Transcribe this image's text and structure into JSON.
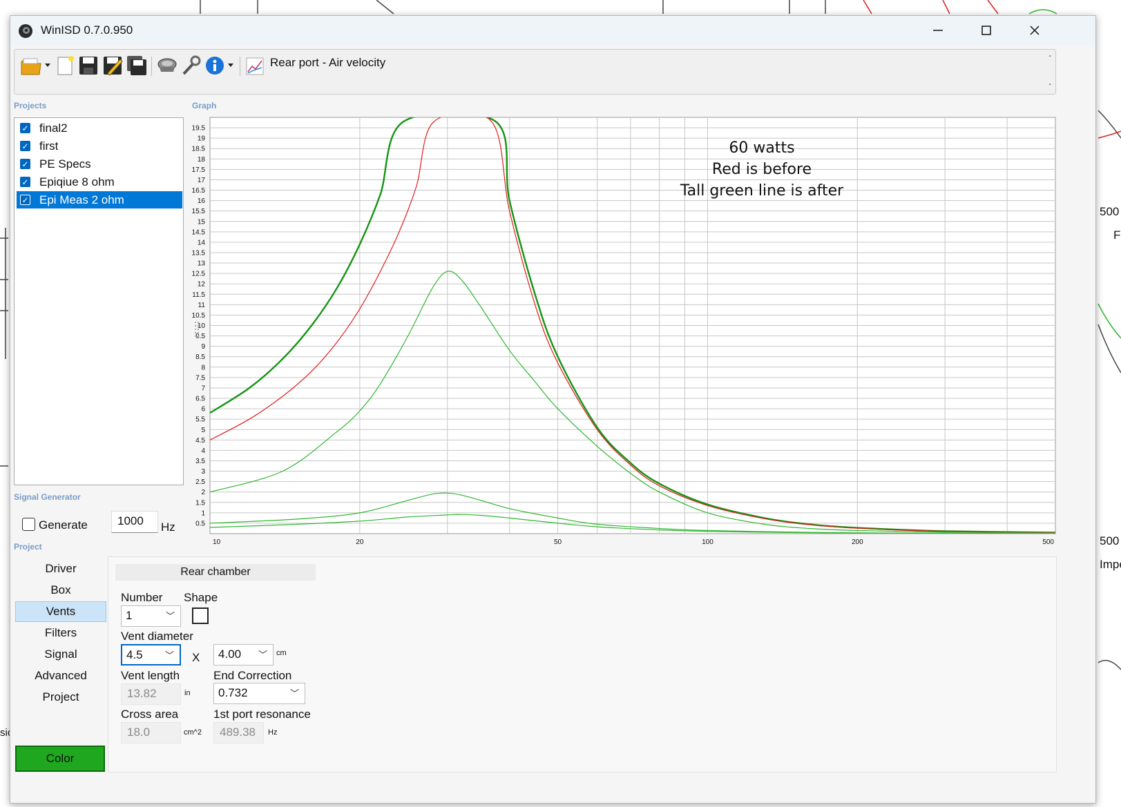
{
  "window": {
    "title": "WinISD 0.7.0.950"
  },
  "toolbar": {
    "icons": [
      "open-folder-icon",
      "new-project-icon",
      "save-icon",
      "save-as-icon",
      "save-all-icon",
      "driver-icon",
      "wrench-icon",
      "info-icon"
    ],
    "graph_selector": "Rear port - Air velocity",
    "dash_top": "-",
    "dash_bottom": "-"
  },
  "labels": {
    "projects": "Projects",
    "graph": "Graph",
    "signal_generator": "Signal Generator",
    "project": "Project"
  },
  "projects": [
    {
      "name": "final2",
      "checked": true,
      "selected": false
    },
    {
      "name": "first",
      "checked": true,
      "selected": false
    },
    {
      "name": "PE Specs",
      "checked": true,
      "selected": false
    },
    {
      "name": "Epiqiue 8 ohm",
      "checked": true,
      "selected": false
    },
    {
      "name": "Epi Meas 2 ohm",
      "checked": true,
      "selected": true
    }
  ],
  "signal": {
    "generate_label": "Generate",
    "frequency": "1000",
    "unit": "Hz"
  },
  "nav": {
    "items": [
      "Driver",
      "Box",
      "Vents",
      "Filters",
      "Signal",
      "Advanced",
      "Project"
    ],
    "active": "Vents"
  },
  "color_button": {
    "label": "Color",
    "color": "#1fa81f"
  },
  "vents": {
    "header": "Rear chamber",
    "number_label": "Number",
    "number_value": "1",
    "shape_label": "Shape",
    "diameter_label": "Vent diameter",
    "diameter_value": "4.5",
    "x_label": "X",
    "second_value": "4.00",
    "second_unit": "cm",
    "length_label": "Vent length",
    "length_value": "13.82",
    "length_unit": "in",
    "end_corr_label": "End Correction",
    "end_corr_value": "0.732",
    "area_label": "Cross area",
    "area_value": "18.0",
    "area_unit": "cm^2",
    "resonance_label": "1st port resonance",
    "resonance_value": "489.38",
    "resonance_unit": "Hz"
  },
  "chart_data": {
    "type": "line",
    "x_scale": "log",
    "xlim": [
      10,
      500
    ],
    "ylim": [
      0,
      20
    ],
    "x_ticks": [
      "10",
      "20",
      "50",
      "100",
      "200",
      "500"
    ],
    "y_ticks": [
      "0.5",
      "1",
      "1.5",
      "2",
      "2.5",
      "3",
      "3.5",
      "4",
      "4.5",
      "5",
      "5.5",
      "6",
      "6.5",
      "7",
      "7.5",
      "8",
      "8.5",
      "9",
      "9.5",
      "10",
      "10.5",
      "11",
      "11.5",
      "12",
      "12.5",
      "13",
      "13.5",
      "14",
      "14.5",
      "15",
      "15.5",
      "16",
      "16.5",
      "17",
      "17.5",
      "18",
      "18.5",
      "19",
      "19.5"
    ],
    "grid": true,
    "annotation": [
      "60 watts",
      "Red is before",
      "Tall green line is after"
    ],
    "series": [
      {
        "color": "#129412",
        "width": 2.4,
        "x": [
          10,
          12,
          14,
          16,
          18,
          20,
          22,
          24.5,
          37.5,
          40,
          45,
          50,
          60,
          70,
          80,
          100,
          130,
          160,
          200,
          300,
          500
        ],
        "values": [
          5.8,
          7.0,
          8.4,
          10.0,
          11.8,
          13.9,
          16.3,
          19.8,
          19.8,
          16.0,
          11.5,
          8.5,
          5.1,
          3.4,
          2.4,
          1.4,
          0.75,
          0.45,
          0.28,
          0.12,
          0.05
        ]
      },
      {
        "color": "#e21b1b",
        "width": 1.2,
        "x": [
          10,
          12,
          14,
          16,
          18,
          20,
          22,
          24,
          26,
          28.2,
          36.8,
          40,
          45,
          50,
          60,
          70,
          80,
          100,
          130,
          160,
          200,
          300,
          500
        ],
        "values": [
          4.5,
          5.5,
          6.6,
          7.8,
          9.2,
          10.8,
          12.6,
          14.5,
          16.7,
          19.8,
          19.8,
          15.5,
          11.0,
          8.2,
          5.0,
          3.3,
          2.3,
          1.35,
          0.72,
          0.43,
          0.26,
          0.11,
          0.05
        ]
      },
      {
        "color": "#2fb52f",
        "width": 1.2,
        "x": [
          10,
          14,
          18,
          20,
          22,
          25,
          28,
          30,
          32,
          35,
          40,
          45,
          50,
          60,
          70,
          80,
          100,
          130,
          160,
          200,
          300,
          500
        ],
        "values": [
          2.0,
          3.0,
          4.9,
          5.9,
          7.2,
          9.5,
          11.8,
          12.6,
          12.2,
          10.9,
          8.8,
          7.3,
          6.0,
          4.2,
          2.9,
          2.0,
          1.0,
          0.45,
          0.25,
          0.15,
          0.07,
          0.03
        ]
      },
      {
        "color": "#2fb52f",
        "width": 1.2,
        "x": [
          10,
          15,
          20,
          25,
          28,
          30,
          32,
          35,
          40,
          50,
          60,
          80,
          100,
          150,
          200,
          300,
          500
        ],
        "values": [
          0.5,
          0.7,
          1.0,
          1.6,
          1.9,
          1.95,
          1.85,
          1.6,
          1.2,
          0.75,
          0.45,
          0.25,
          0.15,
          0.07,
          0.04,
          0.02,
          0.01
        ]
      },
      {
        "color": "#2fb52f",
        "width": 1.2,
        "x": [
          10,
          15,
          20,
          25,
          30,
          32,
          35,
          40,
          50,
          60,
          80,
          100,
          150,
          200,
          300,
          500
        ],
        "values": [
          0.3,
          0.45,
          0.6,
          0.8,
          0.9,
          0.92,
          0.88,
          0.75,
          0.5,
          0.33,
          0.18,
          0.11,
          0.05,
          0.03,
          0.015,
          0.008
        ]
      }
    ]
  }
}
